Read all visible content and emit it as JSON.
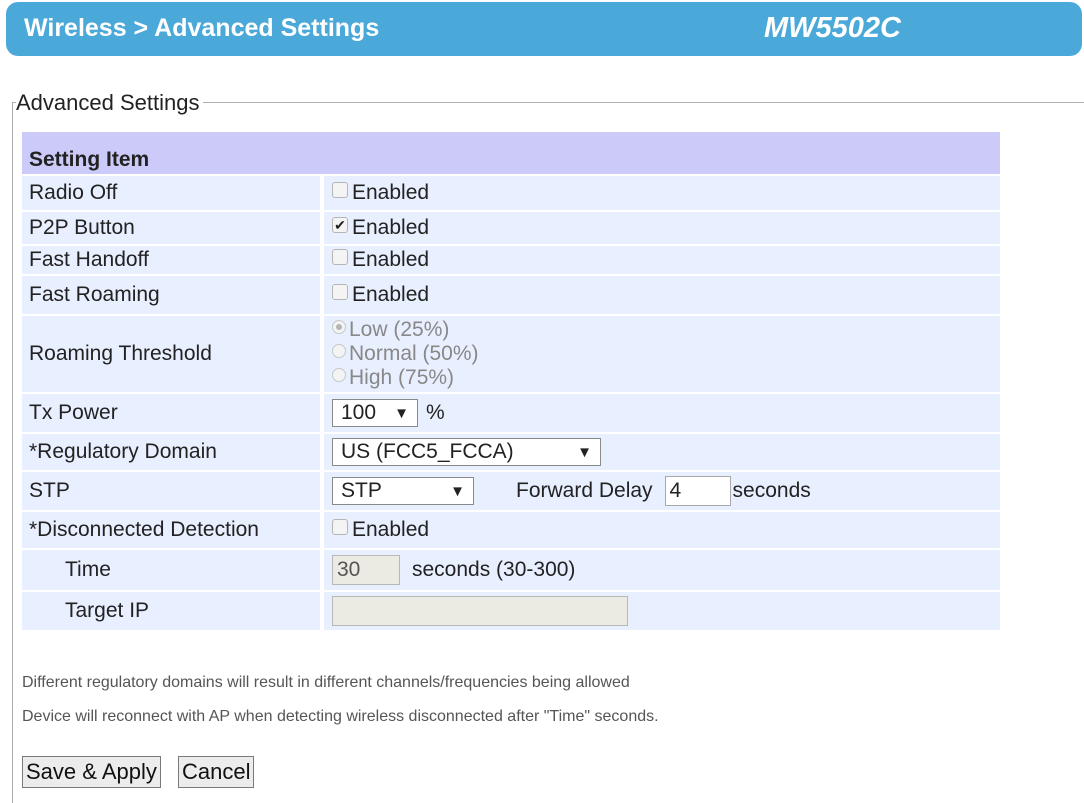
{
  "header": {
    "title": "Wireless > Advanced Settings",
    "model": "MW5502C"
  },
  "section": {
    "legend": "Advanced Settings",
    "column_header": "Setting Item"
  },
  "rows": {
    "radio_off": {
      "label": "Radio Off",
      "checkbox_label": "Enabled",
      "checked": false
    },
    "p2p_button": {
      "label": "P2P Button",
      "checkbox_label": "Enabled",
      "checked": true
    },
    "fast_handoff": {
      "label": "Fast Handoff",
      "checkbox_label": "Enabled",
      "checked": false
    },
    "fast_roaming": {
      "label": "Fast Roaming",
      "checkbox_label": "Enabled",
      "checked": false
    },
    "roaming_threshold": {
      "label": "Roaming Threshold",
      "options": [
        "Low (25%)",
        "Normal (50%)",
        "High (75%)"
      ],
      "selected": "Low (25%)",
      "disabled": true
    },
    "tx_power": {
      "label": "Tx Power",
      "value": "100",
      "unit": "%"
    },
    "regulatory_domain": {
      "label": "*Regulatory Domain",
      "value": "US (FCC5_FCCA)"
    },
    "stp": {
      "label": "STP",
      "value": "STP",
      "forward_delay_label": "Forward Delay",
      "forward_delay_value": "4",
      "forward_delay_unit": "seconds"
    },
    "disconnected_detection": {
      "label": "*Disconnected Detection",
      "checkbox_label": "Enabled",
      "checked": false
    },
    "time": {
      "label": "Time",
      "value": "30",
      "unit": "seconds (30-300)"
    },
    "target_ip": {
      "label": "Target IP",
      "value": ""
    }
  },
  "notes": [
    "Different regulatory domains will result in different channels/frequencies being allowed",
    "Device will reconnect with AP when detecting wireless disconnected after \"Time\" seconds."
  ],
  "buttons": {
    "save": "Save & Apply",
    "cancel": "Cancel"
  }
}
